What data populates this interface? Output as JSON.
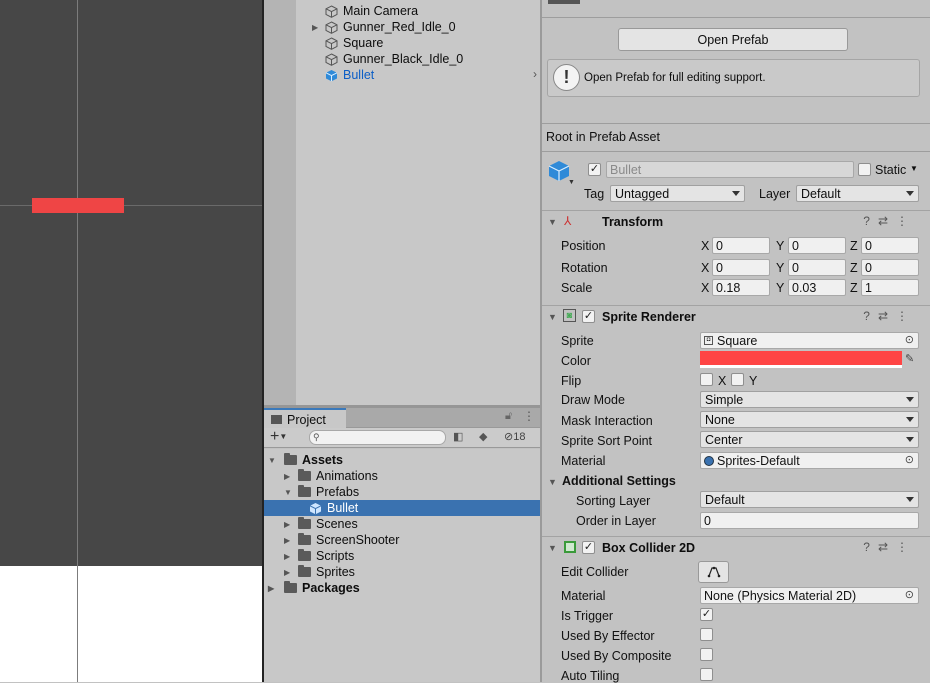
{
  "hierarchy": {
    "items": [
      {
        "label": "Main Camera"
      },
      {
        "label": "Gunner_Red_Idle_0"
      },
      {
        "label": "Square"
      },
      {
        "label": "Gunner_Black_Idle_0"
      },
      {
        "label": "Bullet"
      }
    ]
  },
  "project": {
    "tab": "Project",
    "hidden_count": "18",
    "search_placeholder": "",
    "tree": [
      {
        "label": "Assets"
      },
      {
        "label": "Animations"
      },
      {
        "label": "Prefabs"
      },
      {
        "label": "Bullet"
      },
      {
        "label": "Scenes"
      },
      {
        "label": "ScreenShooter"
      },
      {
        "label": "Scripts"
      },
      {
        "label": "Sprites"
      },
      {
        "label": "Packages"
      }
    ]
  },
  "inspector": {
    "open_prefab": "Open Prefab",
    "info": "Open Prefab for full editing support.",
    "root_label": "Root in Prefab Asset",
    "object": {
      "name": "Bullet",
      "static_label": "Static",
      "tag_label": "Tag",
      "tag": "Untagged",
      "layer_label": "Layer",
      "layer": "Default"
    },
    "transform": {
      "title": "Transform",
      "rows": [
        {
          "label": "Position",
          "x": "0",
          "y": "0",
          "z": "0"
        },
        {
          "label": "Rotation",
          "x": "0",
          "y": "0",
          "z": "0"
        },
        {
          "label": "Scale",
          "x": "0.18",
          "y": "0.03",
          "z": "1"
        }
      ],
      "x": "X",
      "y": "Y",
      "z": "Z"
    },
    "sprite_renderer": {
      "title": "Sprite Renderer",
      "sprite_label": "Sprite",
      "sprite": "Square",
      "color_label": "Color",
      "color": "#ff4545",
      "flip_label": "Flip",
      "flip_x": "X",
      "flip_y": "Y",
      "draw_mode_label": "Draw Mode",
      "draw_mode": "Simple",
      "mask_label": "Mask Interaction",
      "mask": "None",
      "sort_point_label": "Sprite Sort Point",
      "sort_point": "Center",
      "material_label": "Material",
      "material": "Sprites-Default",
      "additional": "Additional Settings",
      "sorting_layer_label": "Sorting Layer",
      "sorting_layer": "Default",
      "order_label": "Order in Layer",
      "order": "0"
    },
    "box_collider": {
      "title": "Box Collider 2D",
      "edit_label": "Edit Collider",
      "material_label": "Material",
      "material": "None (Physics Material 2D)",
      "trigger_label": "Is Trigger",
      "effector_label": "Used By Effector",
      "composite_label": "Used By Composite",
      "tiling_label": "Auto Tiling"
    }
  },
  "colors": {
    "accent": "#3a72b0",
    "bullet": "#ef4545",
    "selection_text": "#0c5ec6"
  }
}
